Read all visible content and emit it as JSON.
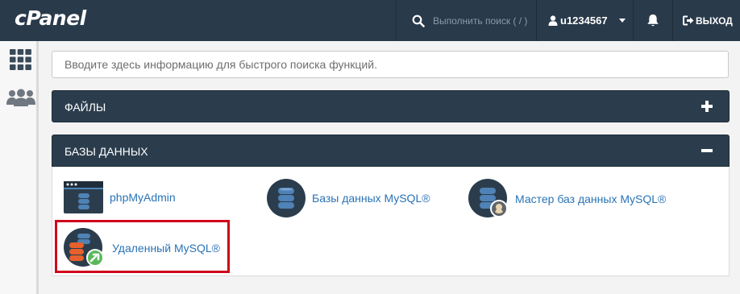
{
  "brand": {
    "logo_text": "cPanel"
  },
  "topbar": {
    "search_placeholder": "Выполнить поиск ( / )",
    "username": "u1234567",
    "logout_label": "ВЫХОД",
    "icons": [
      "search-icon",
      "user-icon",
      "bell-icon",
      "logout-icon"
    ]
  },
  "sidebar": {
    "items": [
      {
        "icon": "grid-icon"
      },
      {
        "icon": "users-icon"
      }
    ]
  },
  "quick_search": {
    "placeholder": "Вводите здесь информацию для быстрого поиска функций."
  },
  "sections": [
    {
      "title": "ФАЙЛЫ",
      "state_icon": "plus-icon",
      "expanded": false
    },
    {
      "title": "БАЗЫ ДАННЫХ",
      "state_icon": "minus-icon",
      "expanded": true,
      "apps": [
        {
          "label": "phpMyAdmin",
          "icon": "phpmyadmin-icon"
        },
        {
          "label": "Базы данных MySQL®",
          "icon": "mysql-database-icon"
        },
        {
          "label": "Мастер баз данных MySQL®",
          "icon": "mysql-wizard-icon"
        },
        {
          "label": "Удаленный MySQL®",
          "icon": "remote-mysql-icon",
          "highlighted": true
        }
      ]
    }
  ],
  "colors": {
    "topbar": "#293a4a",
    "panel_header": "#2b3d4d",
    "link": "#2a73b5",
    "highlight": "#d0021b",
    "db_orange": "#e8602c",
    "db_blue": "#4f82b6",
    "badge_green": "#5cb85c"
  }
}
